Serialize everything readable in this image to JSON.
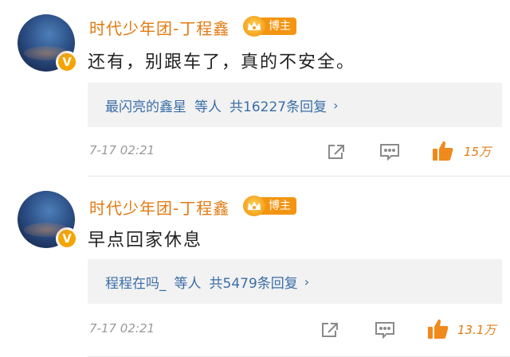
{
  "comments": [
    {
      "username": "时代少年团-丁程鑫",
      "badge_label": "博主",
      "verified_mark": "V",
      "text": "还有，别跟车了，真的不安全。",
      "reply_link": {
        "name": "最闪亮的鑫星",
        "suffix": "等人",
        "count_text": "共16227条回复",
        "chevron": "›"
      },
      "timestamp": "7-17 02:21",
      "likes": "15万",
      "icons": [
        "share-icon",
        "comment-icon",
        "like-icon"
      ]
    },
    {
      "username": "时代少年团-丁程鑫",
      "badge_label": "博主",
      "verified_mark": "V",
      "text": "早点回家休息",
      "reply_link": {
        "name": "程程在吗_",
        "suffix": "等人",
        "count_text": "共5479条回复",
        "chevron": "›"
      },
      "timestamp": "7-17 02:21",
      "likes": "13.1万",
      "icons": [
        "share-icon",
        "comment-icon",
        "like-icon"
      ]
    }
  ],
  "colors": {
    "username": "#e27a12",
    "badge": "#f39512",
    "reply_link": "#3b6ea8",
    "reply_bg": "#f2f2f2",
    "like_orange": "#f08a1c"
  }
}
